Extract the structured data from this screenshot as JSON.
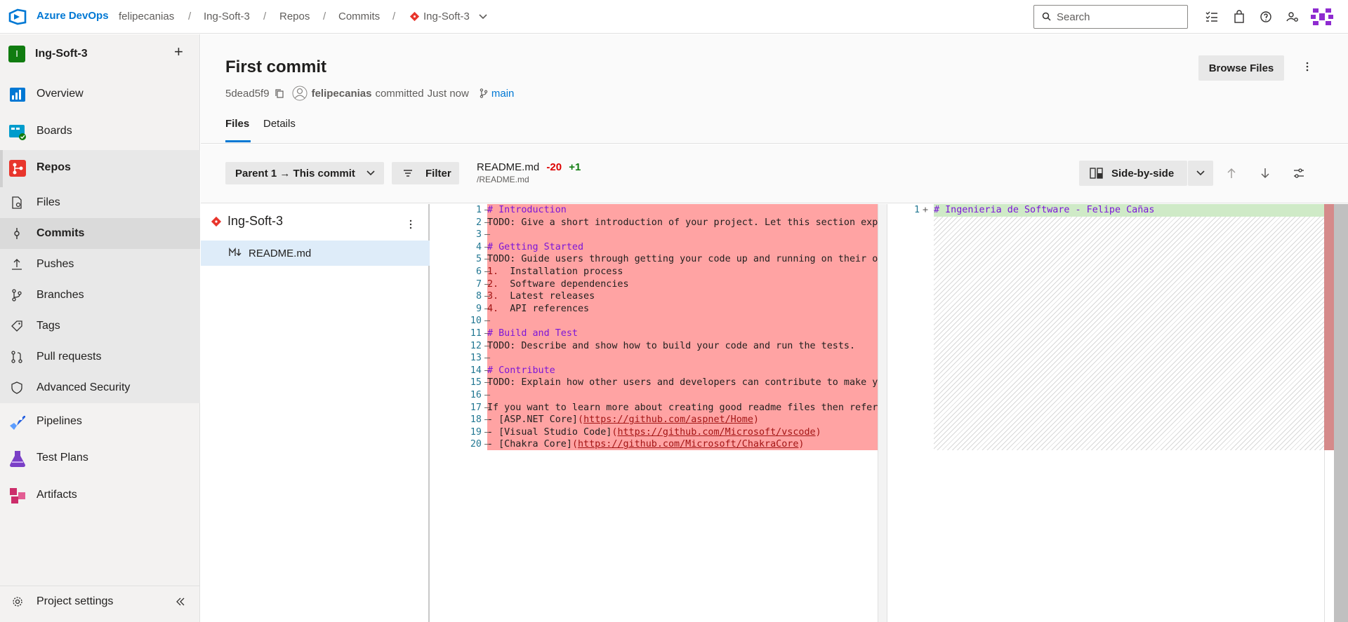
{
  "topbar": {
    "brand": "Azure DevOps",
    "org": "felipecanias",
    "crumbs": [
      "Ing-Soft-3",
      "Repos",
      "Commits",
      "Ing-Soft-3"
    ],
    "search_placeholder": "Search"
  },
  "sidebar": {
    "project_initial": "I",
    "project_name": "Ing-Soft-3",
    "items": [
      {
        "label": "Overview"
      },
      {
        "label": "Boards"
      },
      {
        "label": "Repos"
      },
      {
        "label": "Files"
      },
      {
        "label": "Commits"
      },
      {
        "label": "Pushes"
      },
      {
        "label": "Branches"
      },
      {
        "label": "Tags"
      },
      {
        "label": "Pull requests"
      },
      {
        "label": "Advanced Security"
      },
      {
        "label": "Pipelines"
      },
      {
        "label": "Test Plans"
      },
      {
        "label": "Artifacts"
      }
    ],
    "settings_label": "Project settings"
  },
  "commit": {
    "title": "First commit",
    "hash": "5dead5f9",
    "author": "felipecanias",
    "action": "committed",
    "time": "Just now",
    "branch": "main",
    "browse_label": "Browse Files"
  },
  "tabs": [
    "Files",
    "Details"
  ],
  "toolbar": {
    "parent_label": "Parent 1 → This commit",
    "filter_label": "Filter",
    "file_name": "README.md",
    "deletions": "-20",
    "additions": "+1",
    "file_path": "/README.md",
    "view_label": "Side-by-side"
  },
  "tree": {
    "repo": "Ing-Soft-3",
    "file": "README.md"
  },
  "diff": {
    "left_lines": [
      {
        "n": "1",
        "t": "# Introduction"
      },
      {
        "n": "2",
        "t": "TODO: Give a short introduction of your project. Let this section expl"
      },
      {
        "n": "3",
        "t": ""
      },
      {
        "n": "4",
        "t": "# Getting Started"
      },
      {
        "n": "5",
        "t": "TODO: Guide users through getting your code up and running on their ow"
      },
      {
        "n": "6",
        "t": "1.  Installation process"
      },
      {
        "n": "7",
        "t": "2.  Software dependencies"
      },
      {
        "n": "8",
        "t": "3.  Latest releases"
      },
      {
        "n": "9",
        "t": "4.  API references"
      },
      {
        "n": "10",
        "t": ""
      },
      {
        "n": "11",
        "t": "# Build and Test"
      },
      {
        "n": "12",
        "t": "TODO: Describe and show how to build your code and run the tests."
      },
      {
        "n": "13",
        "t": ""
      },
      {
        "n": "14",
        "t": "# Contribute"
      },
      {
        "n": "15",
        "t": "TODO: Explain how other users and developers can contribute to make yo"
      },
      {
        "n": "16",
        "t": ""
      },
      {
        "n": "17",
        "t": "If you want to learn more about creating good readme files then refer"
      },
      {
        "n": "18",
        "t": "- [ASP.NET Core](https://github.com/aspnet/Home)"
      },
      {
        "n": "19",
        "t": "- [Visual Studio Code](https://github.com/Microsoft/vscode)"
      },
      {
        "n": "20",
        "t": "- [Chakra Core](https://github.com/Microsoft/ChakraCore)"
      }
    ],
    "right_lines": [
      {
        "n": "1",
        "t": "# Ingenieria de Software - Felipe Cañas"
      }
    ]
  },
  "colors": {
    "accent": "#0078d4",
    "deleted": "#ffa3a3",
    "added": "#cfeac7"
  }
}
